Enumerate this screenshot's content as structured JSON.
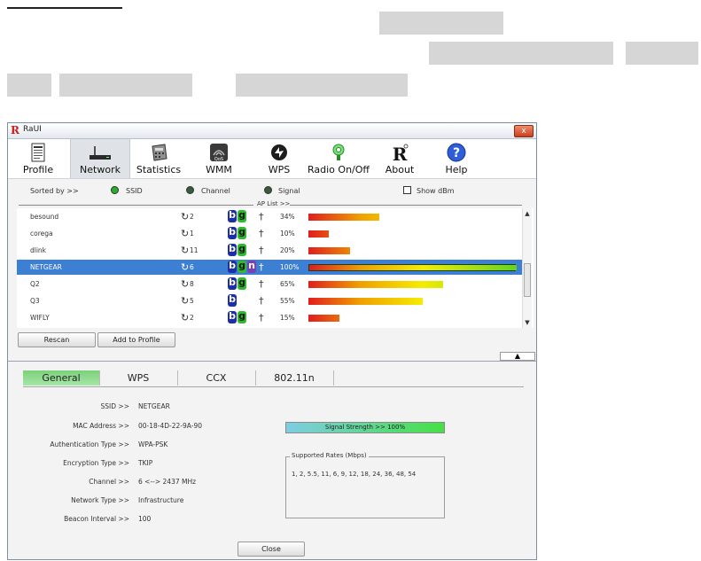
{
  "window": {
    "title": "RaUI",
    "close_symbol": "x"
  },
  "toolbar": {
    "items": [
      {
        "label": "Profile",
        "icon": "profile-icon"
      },
      {
        "label": "Network",
        "icon": "network-icon"
      },
      {
        "label": "Statistics",
        "icon": "statistics-icon"
      },
      {
        "label": "WMM",
        "icon": "wmm-icon"
      },
      {
        "label": "WPS",
        "icon": "wps-icon"
      },
      {
        "label": "Radio On/Off",
        "icon": "radio-icon"
      },
      {
        "label": "About",
        "icon": "about-icon"
      },
      {
        "label": "Help",
        "icon": "help-icon"
      }
    ],
    "active": "Network"
  },
  "sort": {
    "label": "Sorted by >>",
    "options": [
      {
        "label": "SSID",
        "selected": true
      },
      {
        "label": "Channel",
        "selected": false
      },
      {
        "label": "Signal",
        "selected": false
      }
    ],
    "show_dbm_label": "Show dBm",
    "show_dbm_checked": false
  },
  "ap_list": {
    "caption": "AP List >>",
    "rows": [
      {
        "ssid": "besound",
        "channel": "2",
        "modes": [
          "b",
          "g"
        ],
        "signal_label": "34%",
        "signal": 34,
        "selected": false
      },
      {
        "ssid": "corega",
        "channel": "1",
        "modes": [
          "b",
          "g"
        ],
        "signal_label": "10%",
        "signal": 10,
        "selected": false
      },
      {
        "ssid": "dlink",
        "channel": "11",
        "modes": [
          "b",
          "g"
        ],
        "signal_label": "20%",
        "signal": 20,
        "selected": false
      },
      {
        "ssid": "NETGEAR",
        "channel": "6",
        "modes": [
          "b",
          "g",
          "n"
        ],
        "signal_label": "100%",
        "signal": 100,
        "selected": true
      },
      {
        "ssid": "Q2",
        "channel": "8",
        "modes": [
          "b",
          "g"
        ],
        "signal_label": "65%",
        "signal": 65,
        "selected": false
      },
      {
        "ssid": "Q3",
        "channel": "5",
        "modes": [
          "b"
        ],
        "signal_label": "55%",
        "signal": 55,
        "selected": false
      },
      {
        "ssid": "WIFLY",
        "channel": "2",
        "modes": [
          "b",
          "g"
        ],
        "signal_label": "15%",
        "signal": 15,
        "selected": false
      }
    ]
  },
  "buttons": {
    "rescan": "Rescan",
    "add_to_profile": "Add to Profile",
    "close": "Close"
  },
  "tabs": [
    {
      "label": "General",
      "active": true
    },
    {
      "label": "WPS",
      "active": false
    },
    {
      "label": "CCX",
      "active": false
    },
    {
      "label": "802.11n",
      "active": false
    }
  ],
  "general": {
    "fields": [
      {
        "label": "SSID >>",
        "value": "NETGEAR"
      },
      {
        "label": "MAC Address >>",
        "value": "00-18-4D-22-9A-90"
      },
      {
        "label": "Authentication Type >>",
        "value": "WPA-PSK"
      },
      {
        "label": "Encryption Type >>",
        "value": "TKIP"
      },
      {
        "label": "Channel >>",
        "value": "6 <--> 2437 MHz"
      },
      {
        "label": "Network Type >>",
        "value": "Infrastructure"
      },
      {
        "label": "Beacon Interval >>",
        "value": "100"
      }
    ],
    "signal_strength_label": "Signal Strength >> 100%",
    "signal_strength": 100,
    "supported_rates_title": "Supported Rates (Mbps)",
    "supported_rates": "1, 2, 5.5, 11, 6, 9, 12, 18, 24, 36, 48, 54"
  },
  "colors": {
    "selected_row": "#3d7fd2",
    "active_tab": "#7bd07b",
    "mode_b": "#1c2fa8",
    "mode_g": "#2fb92f",
    "mode_n": "#7a3fb5"
  }
}
